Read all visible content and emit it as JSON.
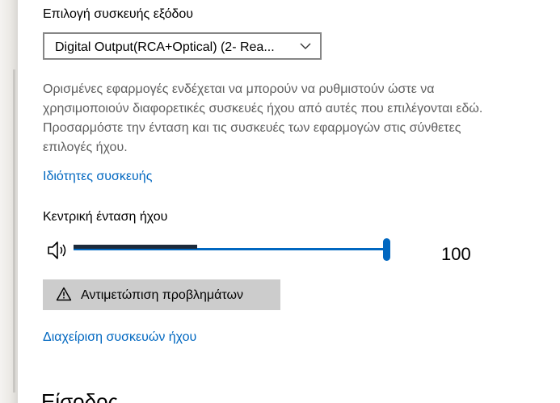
{
  "output_device": {
    "label": "Επιλογή συσκευής εξόδου",
    "selected": "Digital Output(RCA+Optical) (2- Rea...",
    "description": "Ορισμένες εφαρμογές ενδέχεται να μπορούν να ρυθμιστούν ώστε να χρησιμοποιούν διαφορετικές συσκευές ήχου από αυτές που επιλέγονται εδώ. Προσαρμόστε την ένταση και τις συσκευές των εφαρμογών στις σύνθετες επιλογές ήχου.",
    "device_properties_link": "Ιδιότητες συσκευής"
  },
  "master_volume": {
    "label": "Κεντρική ένταση ήχου",
    "value": 100,
    "value_text": "100",
    "icon": "speaker-icon"
  },
  "troubleshoot": {
    "label": "Αντιμετώπιση προβλημάτων",
    "icon": "warning-icon"
  },
  "manage_devices_link": "Διαχείριση συσκευών ήχου",
  "next_section_heading": "Είσοδος",
  "colors": {
    "accent": "#0067c0",
    "link": "#0067c0",
    "secondary_text": "#5f5f5f",
    "button_bg": "#cccccc"
  }
}
